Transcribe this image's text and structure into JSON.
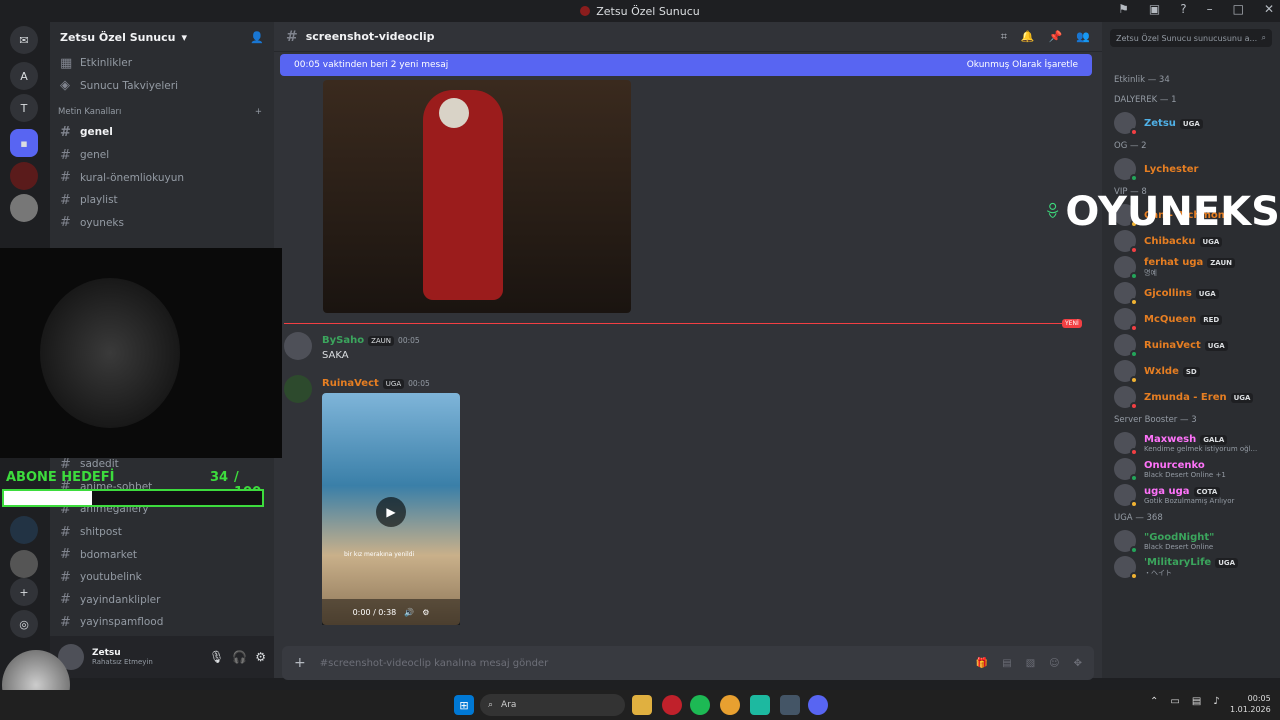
{
  "window": {
    "title": "Zetsu Özel Sunucu"
  },
  "guilds": [
    "A",
    "T"
  ],
  "server": {
    "name": "Zetsu Özel Sunucu",
    "top_items": [
      "Etkinlikler",
      "Sunucu Takviyeleri"
    ],
    "category": "Metin Kanalları",
    "channels": [
      "genel",
      "genel",
      "kural-önemliokuyun",
      "playlist",
      "oyuneks"
    ],
    "channels_lower": [
      "sadedit",
      "anime-sohbet",
      "animegallery",
      "shitpost",
      "bdomarket",
      "youtubelink",
      "yayindanklipler",
      "yayinspamflood"
    ]
  },
  "user": {
    "name": "Zetsu",
    "status": "Rahatsız Etmeyin"
  },
  "channel": {
    "name": "screenshot-videoclip"
  },
  "banner": {
    "text": "00:05 vaktinden beri 2 yeni mesaj",
    "action": "Okunmuş Olarak İşaretle"
  },
  "new_label": "YENİ",
  "messages": [
    {
      "user": "BySaho",
      "color": "#3ba55d",
      "tag": "ZAUN",
      "time": "00:05",
      "text": "SAKA"
    },
    {
      "user": "RuinaVect",
      "color": "#e67e22",
      "tag": "UGA",
      "time": "00:05",
      "video_caption": "bir kız merakına yenildi",
      "video_time": "0:00 / 0:38"
    }
  ],
  "composer": {
    "placeholder": "#screenshot-videoclip kanalına mesaj gönder"
  },
  "members": {
    "search": "Zetsu Özel Sunucu sunucusunu a...",
    "header": "Etkinlik — 34",
    "groups": [
      {
        "name": "DALYEREK — 1",
        "items": [
          {
            "name": "Zetsu",
            "tag": "UGA",
            "color": "#4fb0e6"
          }
        ]
      },
      {
        "name": "OG — 2",
        "items": [
          {
            "name": "Lychester",
            "tag": "",
            "color": "#e67e22"
          }
        ]
      },
      {
        "name": "VIP — 8",
        "items": [
          {
            "name": "Can - Richmond",
            "tag": "",
            "color": "#e67e22"
          },
          {
            "name": "Chibacku",
            "tag": "UGA",
            "color": "#e67e22"
          },
          {
            "name": "ferhat uga",
            "tag": "ZAUN",
            "color": "#e67e22",
            "sub": "명예"
          },
          {
            "name": "Gjcollins",
            "tag": "UGA",
            "color": "#e67e22"
          },
          {
            "name": "McQueen",
            "tag": "RED",
            "color": "#e67e22"
          },
          {
            "name": "RuinaVect",
            "tag": "UGA",
            "color": "#e67e22"
          },
          {
            "name": "Wxlde",
            "tag": "SD",
            "color": "#e67e22"
          },
          {
            "name": "Zmunda - Eren",
            "tag": "UGA",
            "color": "#e67e22"
          }
        ]
      },
      {
        "name": "Server Booster — 3",
        "items": [
          {
            "name": "Maxwesh",
            "tag": "GALA",
            "color": "#ff73fa",
            "sub": "Kendime gelmek istiyorum oğl..."
          },
          {
            "name": "Onurcenko",
            "tag": "",
            "color": "#ff73fa",
            "sub": "Black Desert Online +1"
          },
          {
            "name": "uga uga",
            "tag": "COTA",
            "color": "#ff73fa",
            "sub": "Gotik Bozulmamış Arılıyor"
          }
        ]
      },
      {
        "name": "UGA — 368",
        "items": [
          {
            "name": "\"GoodNight\"",
            "tag": "",
            "color": "#3ba55d",
            "sub": "Black Desert Online"
          },
          {
            "name": "'MilitaryLife",
            "tag": "UGA",
            "color": "#3ba55d",
            "sub": "・ヘイト"
          }
        ]
      }
    ]
  },
  "overlay": {
    "goal_label": "ABONE HEDEFİ",
    "goal_count": "34",
    "goal_total": "/ 100",
    "goal_progress": 0.34,
    "logo_text": "OYUNEKS"
  },
  "taskbar": {
    "search": "Ara",
    "time": "00:05",
    "date": "1.01.2026"
  }
}
